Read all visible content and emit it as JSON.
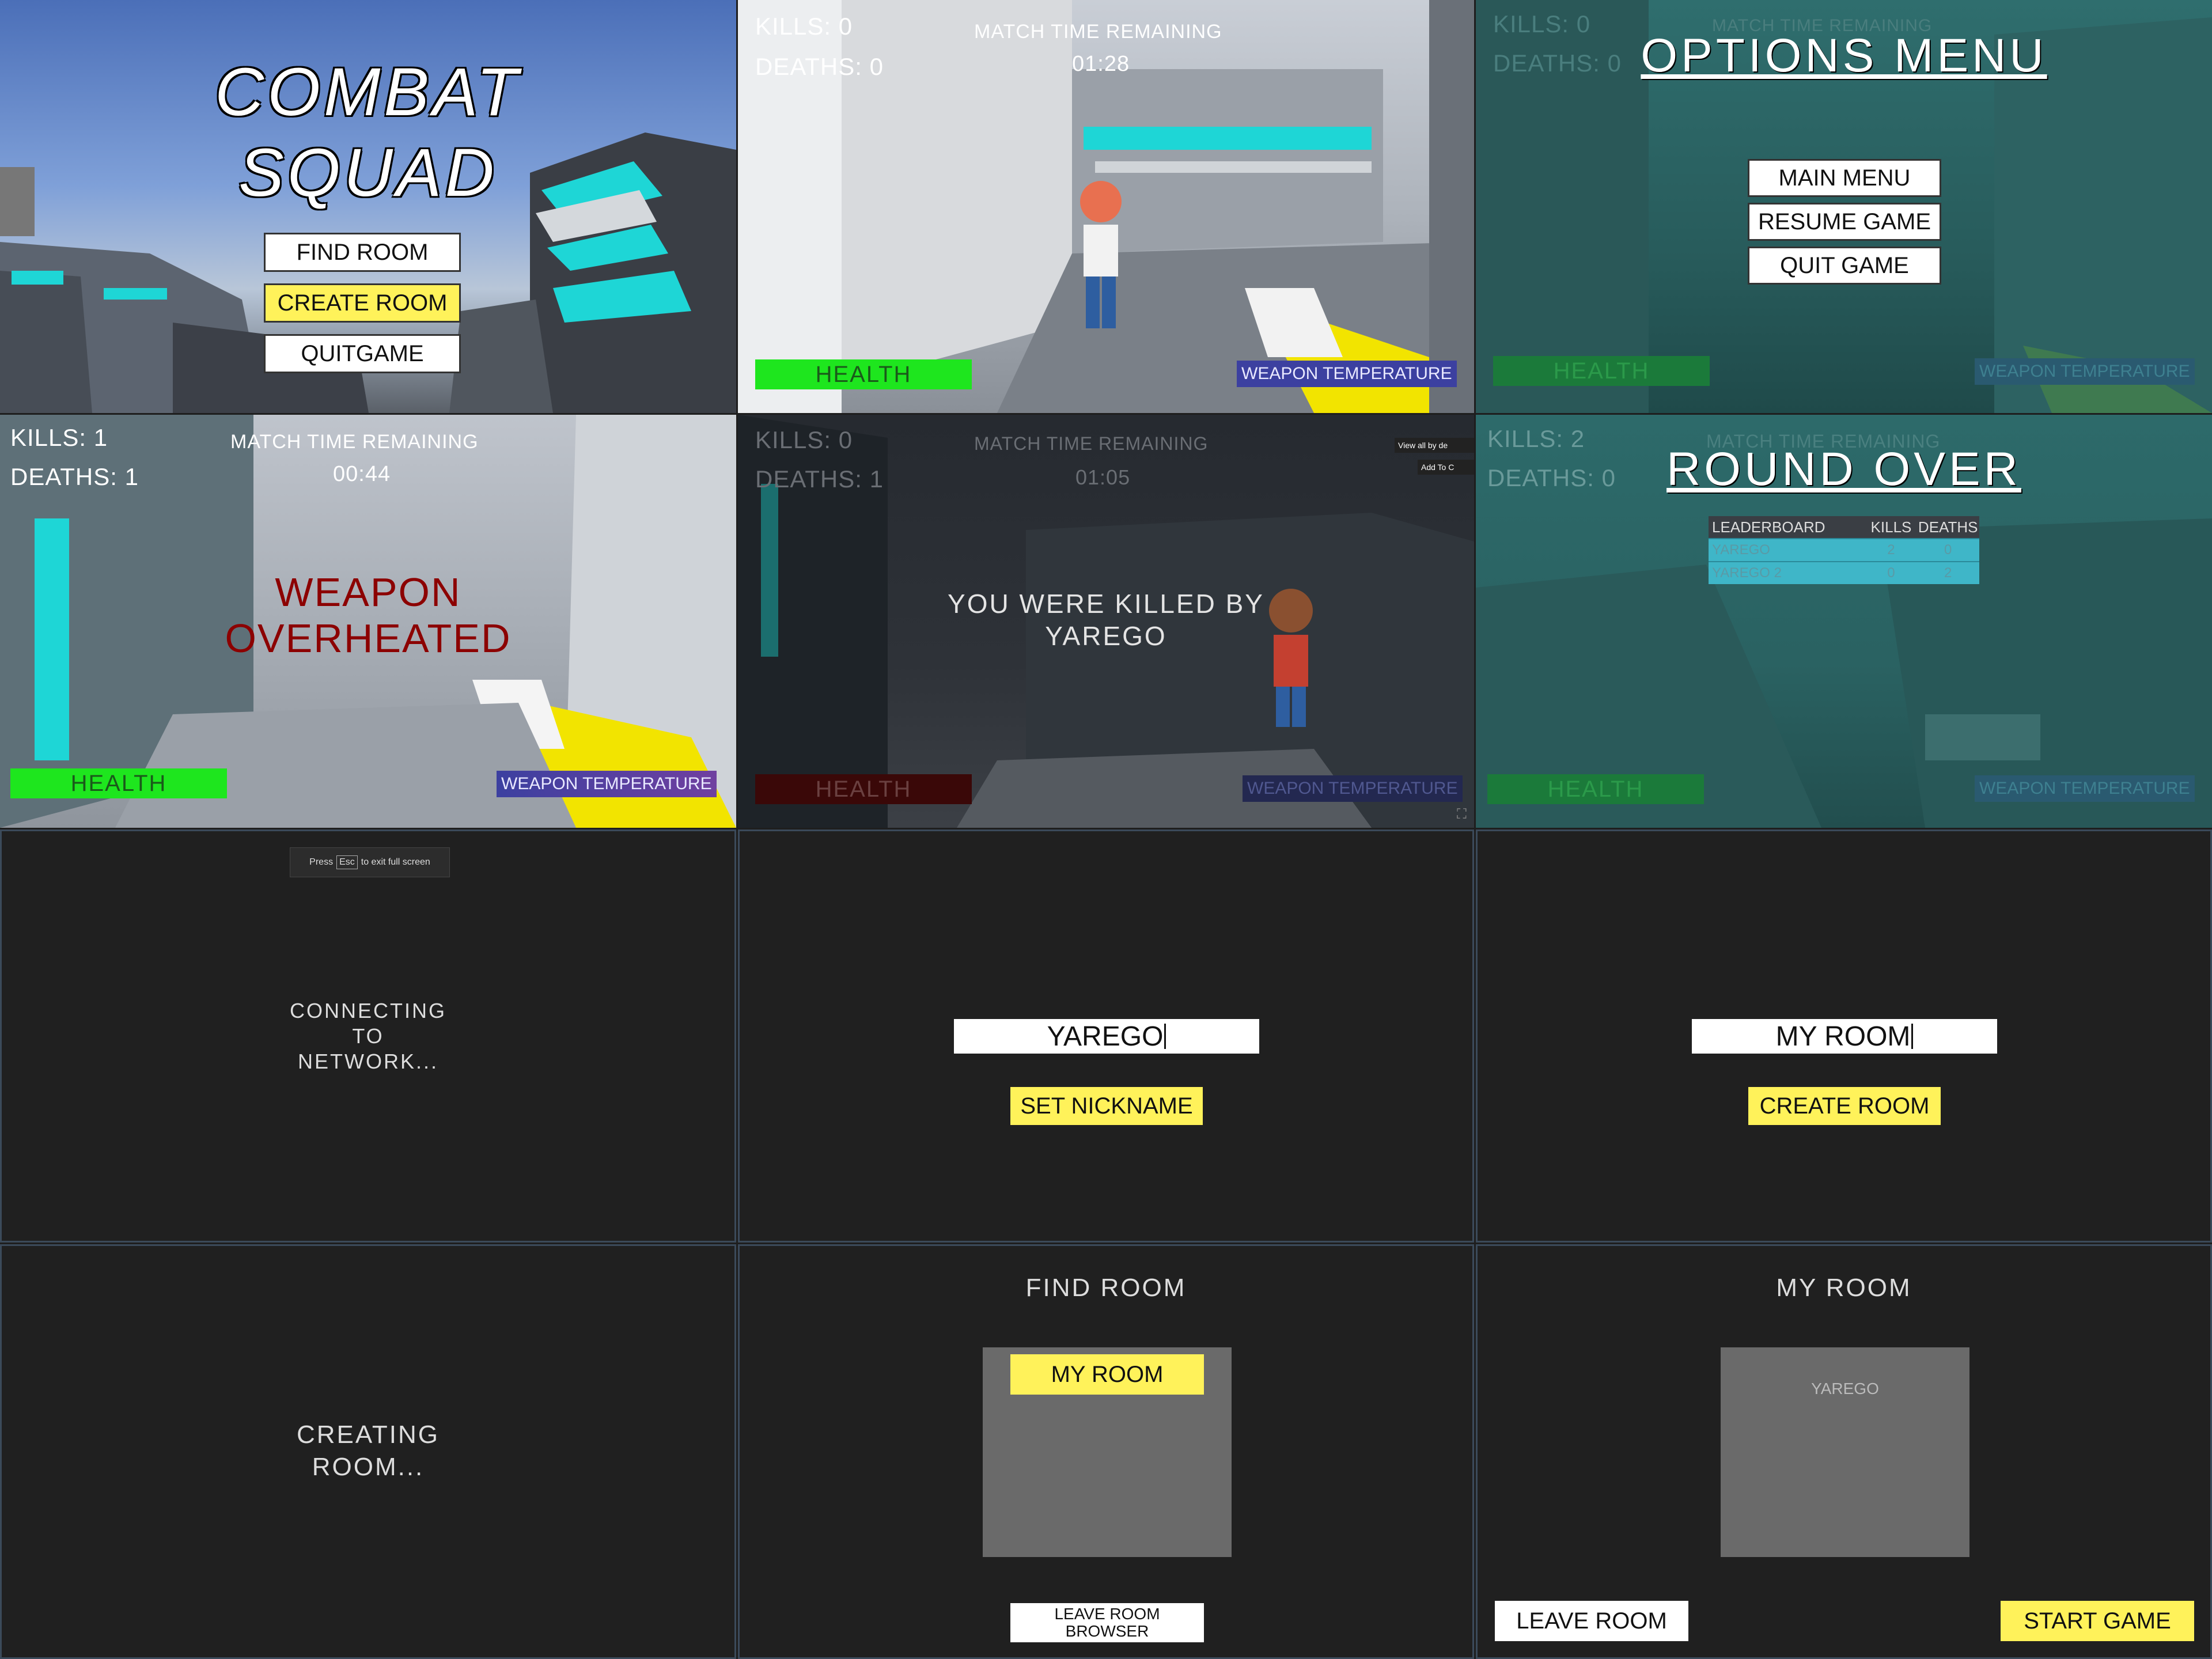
{
  "main_menu": {
    "title_line1": "COMBAT",
    "title_line2": "SQUAD",
    "find_room": "FIND ROOM",
    "create_room": "CREATE ROOM",
    "quit_game": "QUITGAME"
  },
  "gameplay": {
    "kills": "KILLS: 0",
    "deaths": "DEATHS: 0",
    "timer_label": "MATCH TIME REMAINING",
    "timer_value": "01:28",
    "health": "HEALTH",
    "weapon_temp": "WEAPON TEMPERATURE"
  },
  "options_menu": {
    "kills": "KILLS: 0",
    "deaths": "DEATHS: 0",
    "timer_label": "MATCH TIME REMAINING",
    "title": "OPTIONS MENU",
    "main_menu": "MAIN MENU",
    "resume_game": "RESUME GAME",
    "quit_game": "QUIT GAME",
    "health": "HEALTH",
    "weapon_temp": "WEAPON TEMPERATURE"
  },
  "overheated": {
    "kills": "KILLS: 1",
    "deaths": "DEATHS: 1",
    "timer_label": "MATCH TIME REMAINING",
    "timer_value": "00:44",
    "warning_line1": "WEAPON",
    "warning_line2": "OVERHEATED",
    "health": "HEALTH",
    "weapon_temp": "WEAPON TEMPERATURE"
  },
  "killed": {
    "kills": "KILLS: 0",
    "deaths": "DEATHS: 1",
    "timer_label": "MATCH TIME REMAINING",
    "timer_value": "01:05",
    "message_line1": "YOU WERE KILLED BY",
    "message_line2": "YAREGO",
    "overlay_view_all": "View all by de",
    "overlay_add": "Add To C",
    "health": "HEALTH",
    "weapon_temp": "WEAPON TEMPERATURE"
  },
  "round_over": {
    "kills": "KILLS: 2",
    "deaths": "DEATHS: 0",
    "timer_label": "MATCH TIME REMAINING",
    "title": "ROUND OVER",
    "leaderboard_header": [
      "LEADERBOARD",
      "KILLS",
      "DEATHS"
    ],
    "leaderboard_rows": [
      {
        "name": "YAREGO",
        "kills": "2",
        "deaths": "0"
      },
      {
        "name": "YAREGO 2",
        "kills": "0",
        "deaths": "2"
      }
    ],
    "health": "HEALTH",
    "weapon_temp": "WEAPON TEMPERATURE"
  },
  "connecting": {
    "fullscreen_press": "Press",
    "fullscreen_key": "Esc",
    "fullscreen_rest": "to exit full screen",
    "line1": "CONNECTING",
    "line2": "TO",
    "line3": "NETWORK..."
  },
  "nickname": {
    "input_value": "YAREGO",
    "set_nickname": "SET NICKNAME"
  },
  "create_room_screen": {
    "input_value": "MY ROOM",
    "create_room": "CREATE ROOM"
  },
  "creating": {
    "line1": "CREATING",
    "line2": "ROOM..."
  },
  "find_room": {
    "title": "FIND ROOM",
    "room_button": "MY ROOM",
    "leave_line1": "LEAVE ROOM",
    "leave_line2": "BROWSER"
  },
  "my_room": {
    "title": "MY ROOM",
    "player": "YAREGO",
    "leave_room": "LEAVE ROOM",
    "start_game": "START GAME"
  },
  "colors": {
    "accent_cyan": "#1ed6d6",
    "button_yellow": "#fff25a",
    "health_green": "#1ee61e",
    "temp_blue": "#3c40a0",
    "warning_red": "#8c0000",
    "dark_bg": "#202020"
  }
}
